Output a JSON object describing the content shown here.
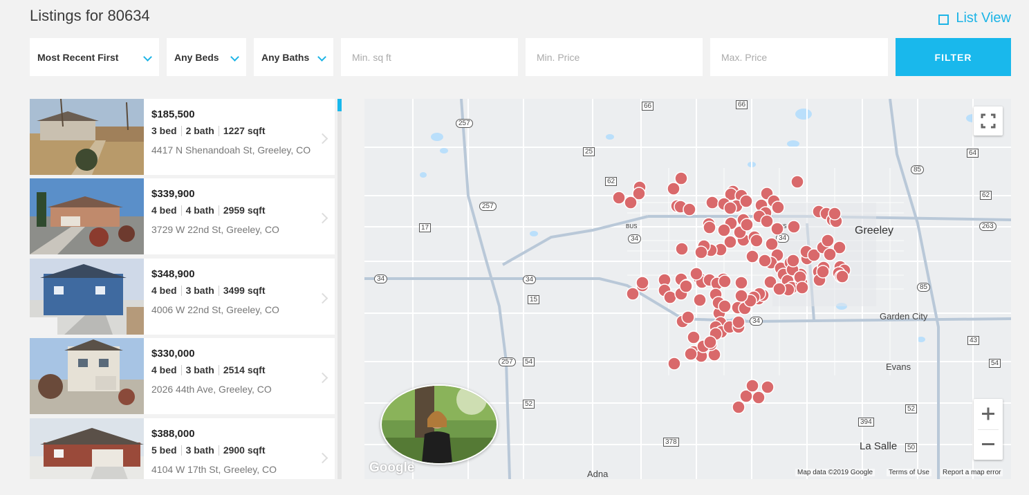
{
  "page": {
    "title": "Listings for 80634",
    "list_view_label": "List View"
  },
  "filters": {
    "sort": "Most Recent First",
    "beds": "Any Beds",
    "baths": "Any Baths",
    "sqft_placeholder": "Min. sq ft",
    "min_price_placeholder": "Min. Price",
    "max_price_placeholder": "Max. Price",
    "filter_label": "FILTER"
  },
  "listings": [
    {
      "price": "$185,500",
      "beds": "3 bed",
      "baths": "2 bath",
      "sqft": "1227 sqft",
      "address": "4417 N Shenandoah St, Greeley, CO"
    },
    {
      "price": "$339,900",
      "beds": "4 bed",
      "baths": "4 bath",
      "sqft": "2959 sqft",
      "address": "3729 W 22nd St, Greeley, CO"
    },
    {
      "price": "$348,900",
      "beds": "4 bed",
      "baths": "3 bath",
      "sqft": "3499 sqft",
      "address": "4006 W 22nd St, Greeley, CO"
    },
    {
      "price": "$330,000",
      "beds": "4 bed",
      "baths": "3 bath",
      "sqft": "2514 sqft",
      "address": "2026 44th Ave, Greeley, CO"
    },
    {
      "price": "$388,000",
      "beds": "5 bed",
      "baths": "3 bath",
      "sqft": "2900 sqft",
      "address": "4104 W 17th St, Greeley, CO"
    }
  ],
  "map": {
    "place_labels": {
      "greeley": "Greeley",
      "garden_city": "Garden City",
      "evans": "Evans",
      "la_salle": "La Salle",
      "adna": "Adna"
    },
    "road_shields": {
      "r66a": "66",
      "r66b": "66",
      "r257a": "257",
      "r257b": "257",
      "r257c": "257",
      "r25": "25",
      "r62a": "62",
      "r62b": "62",
      "r17": "17",
      "r34a": "34",
      "r34b": "34",
      "r34c": "34",
      "r34d": "34",
      "r34e": "34",
      "r15": "15",
      "r54a": "54",
      "r54b": "54",
      "r52a": "52",
      "r52b": "52",
      "r378": "378",
      "r394": "394",
      "r50": "50",
      "r64": "64",
      "r85a": "85",
      "r85b": "85",
      "r263": "263",
      "r43": "43",
      "bus_a": "BUS",
      "bus_b": "BUS"
    },
    "footer": {
      "data": "Map data ©2019 Google",
      "terms": "Terms of Use",
      "report": "Report a map error"
    },
    "logo": "Google",
    "marker_color": "#d9696b",
    "accent_color": "#19b8ec"
  }
}
